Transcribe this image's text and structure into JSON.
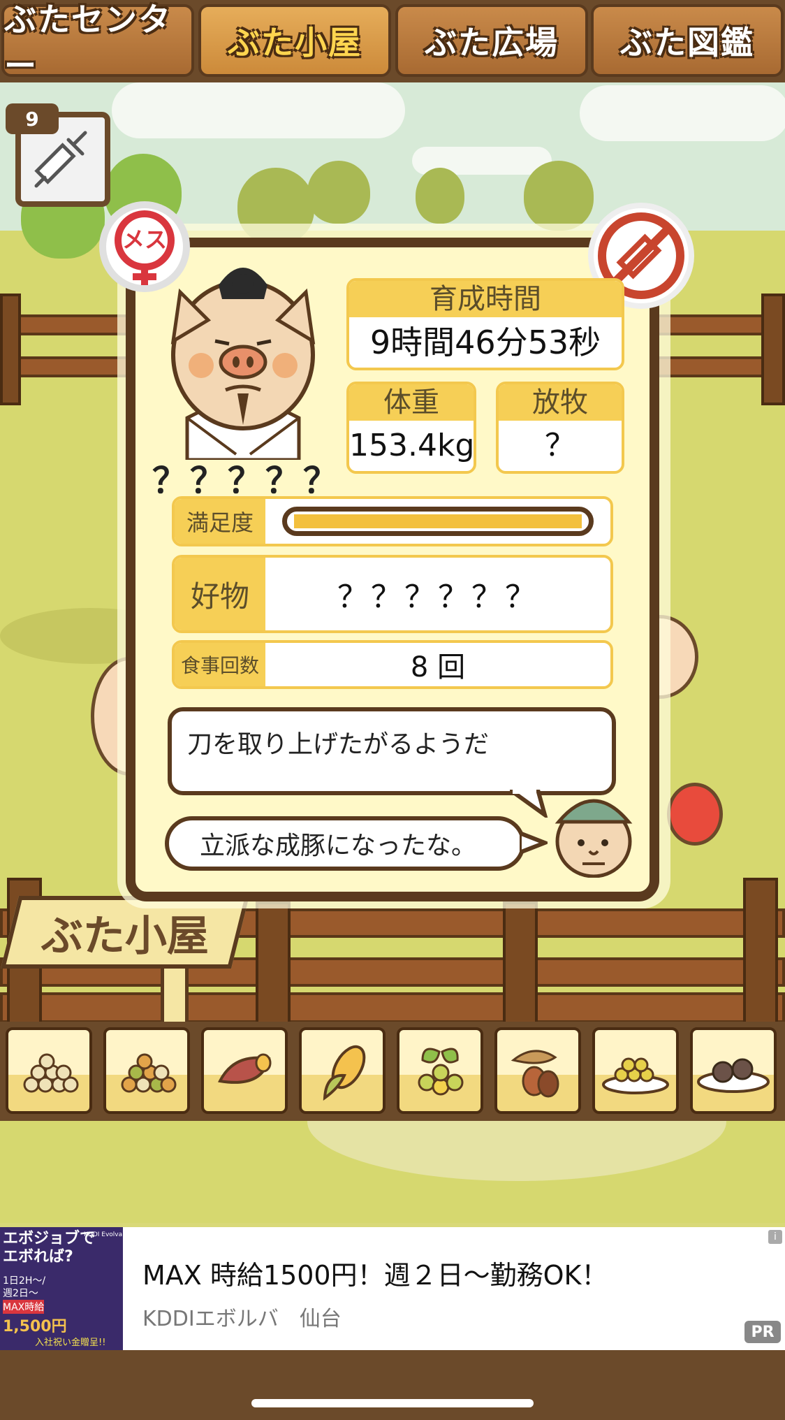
{
  "tabs": [
    {
      "label": "ぶたセンター"
    },
    {
      "label": "ぶた小屋"
    },
    {
      "label": "ぶた広場"
    },
    {
      "label": "ぶた図鑑"
    }
  ],
  "active_tab": "ぶた小屋",
  "syringe": {
    "count": "9",
    "icon": "syringe-icon"
  },
  "gender": {
    "label": "メス",
    "icon": "female-icon",
    "color": "#d9363e"
  },
  "no_injection_icon": "no-syringe-icon",
  "pig": {
    "name": "？？？？？"
  },
  "stats": {
    "growth_time_label": "育成時間",
    "growth_time_value": "9時間46分53秒",
    "weight_label": "体重",
    "weight_value": "153.4kg",
    "grazing_label": "放牧",
    "grazing_value": "？"
  },
  "satisfaction": {
    "label": "満足度",
    "level": 1.0,
    "bar_color": "#f3c03e"
  },
  "favorite": {
    "label": "好物",
    "value": "？？？？？？"
  },
  "meals": {
    "label": "食事回数",
    "value": "8 回"
  },
  "pig_comment": "刀を取り上げたがるようだ",
  "farmer_comment": "立派な成豚になったな。",
  "sign": "ぶた小屋",
  "foods": [
    {
      "icon": "beige-grain-pile-icon"
    },
    {
      "icon": "mixed-grain-pile-icon"
    },
    {
      "icon": "sweet-potato-icon"
    },
    {
      "icon": "corn-icon"
    },
    {
      "icon": "beans-with-leaves-icon"
    },
    {
      "icon": "acorn-icon"
    },
    {
      "icon": "grain-plate-icon"
    },
    {
      "icon": "meatball-plate-icon"
    }
  ],
  "ad": {
    "headline": "MAX 時給1500円！週２日〜勤務OK！",
    "sub": "KDDIエボルバ　仙台",
    "badge": "PR",
    "info": "i",
    "image_text": [
      "エボジョブで",
      "エボれば?",
      "1日2H〜/",
      "週2日〜",
      "MAX時給",
      "1,500円",
      "入社祝い金贈呈!!"
    ],
    "brand": "KDDI Evolva"
  },
  "colors": {
    "panel_border": "#5a3a1e",
    "stat_yellow": "#f6cf56",
    "wood": "#6b4a2a",
    "grass": "#d6d86f"
  }
}
